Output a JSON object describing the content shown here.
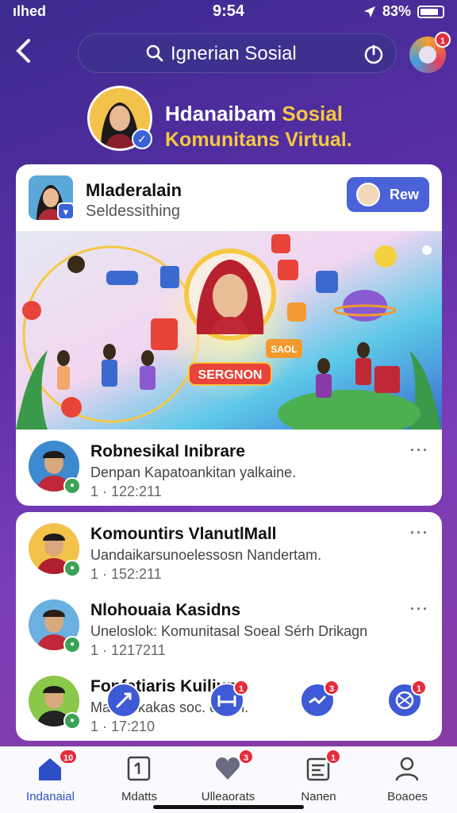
{
  "status_bar": {
    "carrier": "ılhed",
    "time": "9:54",
    "battery": "83%"
  },
  "search": {
    "text": "Ignerian Sosial"
  },
  "profile": {
    "badge": "1"
  },
  "hero": {
    "title_a": "Hdanaibam ",
    "title_b": "Sosial",
    "subtitle": "Komunitans Virtual."
  },
  "community_card": {
    "name": "Mladeralain",
    "description": "Seldessithing",
    "follow_label": "Rew",
    "banner_sign": "SERGNON",
    "banner_tag": "SAOL"
  },
  "posts": [
    {
      "name": "Robnesikal Inibrare",
      "text": "Denpan Kapatoankitan yalkaine.",
      "meta": "1 · 122:211",
      "more": "···"
    },
    {
      "name": "Komountirs VlanutlMall",
      "text": "Uandaikarsunoelessosn Nandertam.",
      "meta": "1 · 152:211",
      "more": "···"
    },
    {
      "name": "Nlohouaia Kasidns",
      "text": "Uneloslok: Komunitasal Soeal Sérh Drikagn",
      "meta": "1 · 1217211",
      "more": "···"
    },
    {
      "name": "Fonfatiaris Kuilium",
      "text": "Ma aoekakas soc.  doirin.",
      "meta": "1 · 17:210",
      "more": "···"
    }
  ],
  "floating_badges": [
    "1",
    "3",
    "1"
  ],
  "bottom_nav": [
    {
      "label": "Indanaial",
      "badge": "10",
      "icon": "home-icon"
    },
    {
      "label": "Mdatts",
      "badge": "",
      "icon": "document-icon"
    },
    {
      "label": "Ulleaorats",
      "badge": "3",
      "icon": "heart-icon"
    },
    {
      "label": "Nanen",
      "badge": "1",
      "icon": "calendar-icon"
    },
    {
      "label": "Boaoes",
      "badge": "",
      "icon": "person-icon"
    }
  ],
  "colors": {
    "accent": "#4a63d8",
    "gold": "#f5c842",
    "badge": "#e52b3a"
  }
}
